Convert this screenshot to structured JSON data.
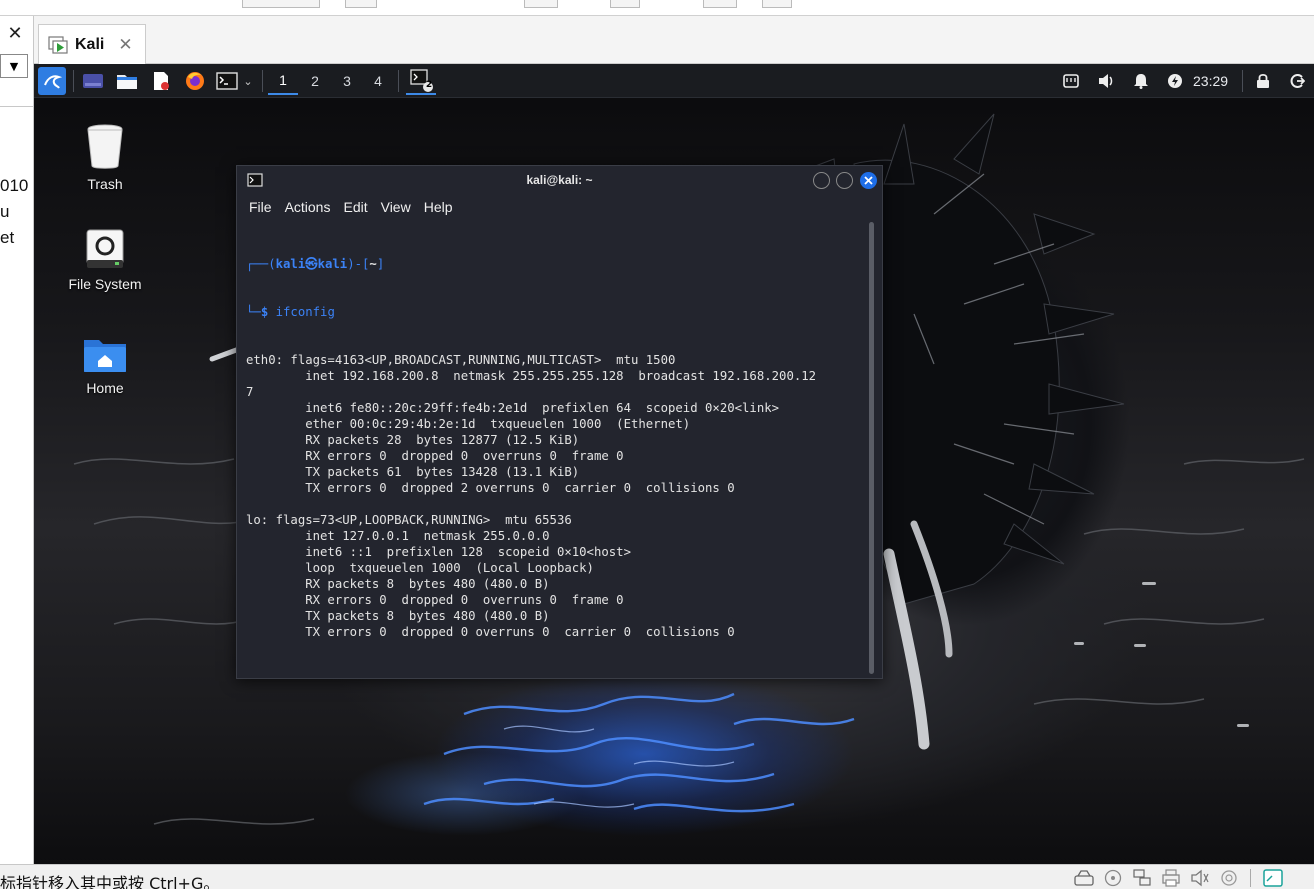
{
  "host": {
    "side_texts": [
      "010",
      "u",
      "et"
    ],
    "status_text": "标指针移入其中或按 Ctrl+G。"
  },
  "vm_tab": {
    "title": "Kali"
  },
  "panel": {
    "workspaces": [
      "1",
      "2",
      "3",
      "4"
    ],
    "active_workspace": "1",
    "terminal_badge": "2",
    "clock": "23:29",
    "accent": "#2f7de2"
  },
  "desktop": {
    "icons": [
      {
        "label": "Trash",
        "icon": "trash-icon"
      },
      {
        "label": "File System",
        "icon": "drive-icon"
      },
      {
        "label": "Home",
        "icon": "home-folder-icon"
      }
    ]
  },
  "terminal": {
    "title": "kali@kali: ~",
    "menu": [
      "File",
      "Actions",
      "Edit",
      "View",
      "Help"
    ],
    "prompt": {
      "user": "kali",
      "sep": "㉿",
      "host": "kali",
      "dir": "~",
      "symbol": "$"
    },
    "command": "ifconfig",
    "output": [
      "eth0: flags=4163<UP,BROADCAST,RUNNING,MULTICAST>  mtu 1500",
      "        inet 192.168.200.8  netmask 255.255.255.128  broadcast 192.168.200.12",
      "7",
      "        inet6 fe80::20c:29ff:fe4b:2e1d  prefixlen 64  scopeid 0×20<link>",
      "        ether 00:0c:29:4b:2e:1d  txqueuelen 1000  (Ethernet)",
      "        RX packets 28  bytes 12877 (12.5 KiB)",
      "        RX errors 0  dropped 0  overruns 0  frame 0",
      "        TX packets 61  bytes 13428 (13.1 KiB)",
      "        TX errors 0  dropped 2 overruns 0  carrier 0  collisions 0",
      "",
      "lo: flags=73<UP,LOOPBACK,RUNNING>  mtu 65536",
      "        inet 127.0.0.1  netmask 255.0.0.0",
      "        inet6 ::1  prefixlen 128  scopeid 0×10<host>",
      "        loop  txqueuelen 1000  (Local Loopback)",
      "        RX packets 8  bytes 480 (480.0 B)",
      "        RX errors 0  dropped 0  overruns 0  frame 0",
      "        TX packets 8  bytes 480 (480.0 B)",
      "        TX errors 0  dropped 0 overruns 0  carrier 0  collisions 0",
      "",
      ""
    ]
  }
}
